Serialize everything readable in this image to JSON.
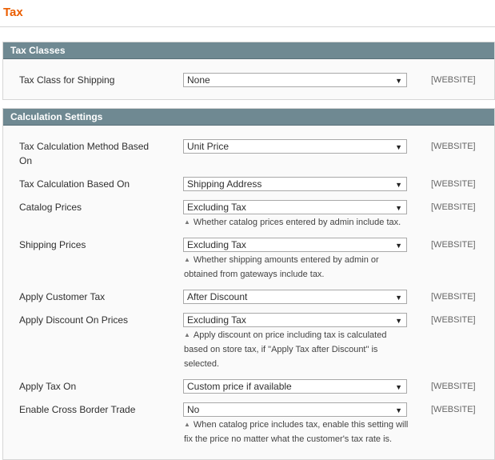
{
  "page": {
    "title": "Tax"
  },
  "tax_classes": {
    "heading": "Tax Classes",
    "rows": [
      {
        "label": "Tax Class for Shipping",
        "value": "None",
        "scope": "[WEBSITE]"
      }
    ]
  },
  "calculation": {
    "heading": "Calculation Settings",
    "rows": [
      {
        "label": "Tax Calculation Method Based On",
        "value": "Unit Price",
        "scope": "[WEBSITE]"
      },
      {
        "label": "Tax Calculation Based On",
        "value": "Shipping Address",
        "scope": "[WEBSITE]"
      },
      {
        "label": "Catalog Prices",
        "value": "Excluding Tax",
        "scope": "[WEBSITE]",
        "note": "Whether catalog prices entered by admin include tax."
      },
      {
        "label": "Shipping Prices",
        "value": "Excluding Tax",
        "scope": "[WEBSITE]",
        "note": "Whether shipping amounts entered by admin or obtained from gateways include tax."
      },
      {
        "label": "Apply Customer Tax",
        "value": "After Discount",
        "scope": "[WEBSITE]"
      },
      {
        "label": "Apply Discount On Prices",
        "value": "Excluding Tax",
        "scope": "[WEBSITE]",
        "note": "Apply discount on price including tax is calculated based on store tax, if \"Apply Tax after Discount\" is selected."
      },
      {
        "label": "Apply Tax On",
        "value": "Custom price if available",
        "scope": "[WEBSITE]"
      },
      {
        "label": "Enable Cross Border Trade",
        "value": "No",
        "scope": "[WEBSITE]",
        "note": "When catalog price includes tax, enable this setting will fix the price no matter what the customer's tax rate is."
      }
    ]
  },
  "icons": {
    "dropdown": "triangle-down",
    "note": "triangle-up"
  }
}
